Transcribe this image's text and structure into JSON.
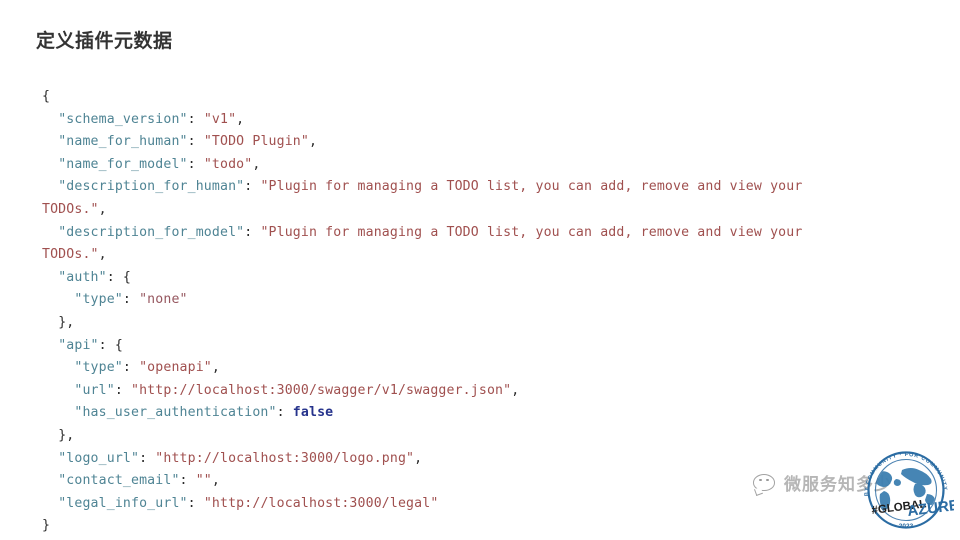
{
  "slide": {
    "title": "定义插件元数据",
    "background_color": "#ffffff"
  },
  "theme": {
    "title_color": "#333333",
    "key_color": "#4f8494",
    "string_color": "#a0504f",
    "boolean_color": "#26338c",
    "punctuation_color": "#2b2b2b"
  },
  "code": {
    "language": "json",
    "lines": [
      {
        "id": "l01",
        "indent": 0,
        "parts": [
          {
            "t": "punct",
            "v": "{"
          }
        ]
      },
      {
        "id": "l02",
        "indent": 1,
        "parts": [
          {
            "t": "key",
            "v": "\"schema_version\""
          },
          {
            "t": "punct",
            "v": ": "
          },
          {
            "t": "str",
            "v": "\"v1\""
          },
          {
            "t": "punct",
            "v": ","
          }
        ]
      },
      {
        "id": "l03",
        "indent": 1,
        "parts": [
          {
            "t": "key",
            "v": "\"name_for_human\""
          },
          {
            "t": "punct",
            "v": ": "
          },
          {
            "t": "str",
            "v": "\"TODO Plugin\""
          },
          {
            "t": "punct",
            "v": ","
          }
        ]
      },
      {
        "id": "l04",
        "indent": 1,
        "parts": [
          {
            "t": "key",
            "v": "\"name_for_model\""
          },
          {
            "t": "punct",
            "v": ": "
          },
          {
            "t": "str",
            "v": "\"todo\""
          },
          {
            "t": "punct",
            "v": ","
          }
        ]
      },
      {
        "id": "l05",
        "indent": 1,
        "parts": [
          {
            "t": "key",
            "v": "\"description_for_human\""
          },
          {
            "t": "punct",
            "v": ": "
          },
          {
            "t": "str",
            "v": "\"Plugin for managing a TODO list, you can add, remove and view your TODOs.\""
          },
          {
            "t": "punct",
            "v": ","
          }
        ]
      },
      {
        "id": "l06",
        "indent": 1,
        "parts": [
          {
            "t": "key",
            "v": "\"description_for_model\""
          },
          {
            "t": "punct",
            "v": ": "
          },
          {
            "t": "str",
            "v": "\"Plugin for managing a TODO list, you can add, remove and view your TODOs.\""
          },
          {
            "t": "punct",
            "v": ","
          }
        ]
      },
      {
        "id": "l07",
        "indent": 1,
        "parts": [
          {
            "t": "key",
            "v": "\"auth\""
          },
          {
            "t": "punct",
            "v": ": {"
          }
        ]
      },
      {
        "id": "l08",
        "indent": 2,
        "parts": [
          {
            "t": "key",
            "v": "\"type\""
          },
          {
            "t": "punct",
            "v": ": "
          },
          {
            "t": "str-mut",
            "v": "\"none\""
          }
        ]
      },
      {
        "id": "l09",
        "indent": 1,
        "parts": [
          {
            "t": "punct",
            "v": "},"
          }
        ]
      },
      {
        "id": "l10",
        "indent": 1,
        "parts": [
          {
            "t": "key",
            "v": "\"api\""
          },
          {
            "t": "punct",
            "v": ": {"
          }
        ]
      },
      {
        "id": "l11",
        "indent": 2,
        "parts": [
          {
            "t": "key",
            "v": "\"type\""
          },
          {
            "t": "punct",
            "v": ": "
          },
          {
            "t": "str",
            "v": "\"openapi\""
          },
          {
            "t": "punct",
            "v": ","
          }
        ]
      },
      {
        "id": "l12",
        "indent": 2,
        "parts": [
          {
            "t": "key",
            "v": "\"url\""
          },
          {
            "t": "punct",
            "v": ": "
          },
          {
            "t": "str",
            "v": "\"http://localhost:3000/swagger/v1/swagger.json\""
          },
          {
            "t": "punct",
            "v": ","
          }
        ]
      },
      {
        "id": "l13",
        "indent": 2,
        "parts": [
          {
            "t": "key",
            "v": "\"has_user_authentication\""
          },
          {
            "t": "punct",
            "v": ": "
          },
          {
            "t": "bool",
            "v": "false"
          }
        ]
      },
      {
        "id": "l14",
        "indent": 1,
        "parts": [
          {
            "t": "punct",
            "v": "},"
          }
        ]
      },
      {
        "id": "l15",
        "indent": 1,
        "parts": [
          {
            "t": "key",
            "v": "\"logo_url\""
          },
          {
            "t": "punct",
            "v": ": "
          },
          {
            "t": "str",
            "v": "\"http://localhost:3000/logo.png\""
          },
          {
            "t": "punct",
            "v": ","
          }
        ]
      },
      {
        "id": "l16",
        "indent": 1,
        "parts": [
          {
            "t": "key",
            "v": "\"contact_email\""
          },
          {
            "t": "punct",
            "v": ": "
          },
          {
            "t": "str",
            "v": "\"\""
          },
          {
            "t": "punct",
            "v": ","
          }
        ]
      },
      {
        "id": "l17",
        "indent": 1,
        "parts": [
          {
            "t": "key",
            "v": "\"legal_info_url\""
          },
          {
            "t": "punct",
            "v": ": "
          },
          {
            "t": "str",
            "v": "\"http://localhost:3000/legal\""
          }
        ]
      },
      {
        "id": "l18",
        "indent": 0,
        "parts": [
          {
            "t": "punct",
            "v": "}"
          }
        ]
      }
    ]
  },
  "watermark": {
    "icon": "wechat-icon",
    "account_name": "微服务知多少"
  },
  "badge": {
    "name": "global-azure-logo",
    "arc_text_left": "BY COMMUNITY",
    "arc_text_right": "FOR COMMUNITY",
    "arc_text_full": "BY COMMUNITY · FOR COMMUNITY ·",
    "wordmark_hash": "#GLOBAL",
    "wordmark_main": "AZURE",
    "year": "2023",
    "color": "#2b6ca3"
  }
}
